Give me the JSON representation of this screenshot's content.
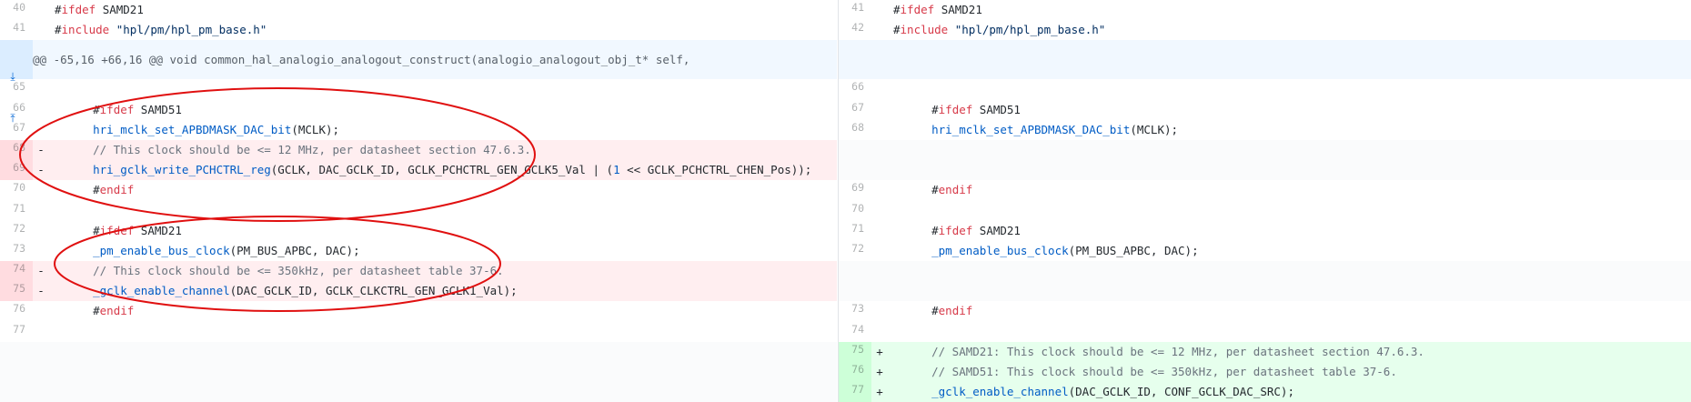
{
  "hunk_header": "@@ -65,16 +66,16 @@ void common_hal_analogio_analogout_construct(analogio_analogout_obj_t* self,",
  "expand_icons": [
    "expand-down-icon",
    "expand-up-icon"
  ],
  "left": {
    "ctx": [
      {
        "num": "40",
        "pre": "#",
        "kw": "ifdef",
        "post": " SAMD21"
      },
      {
        "num": "41",
        "pre": "#",
        "kw": "include",
        "str": " \"hpl/pm/hpl_pm_base.h\""
      }
    ],
    "r65": {
      "num": "65"
    },
    "r66": {
      "num": "66",
      "pre": "    #",
      "kw": "ifdef",
      "post": " SAMD51"
    },
    "r67": {
      "num": "67",
      "fn": "    hri_mclk_set_APBDMASK_DAC_bit",
      "post": "(MCLK);"
    },
    "r68": {
      "num": "68",
      "sign": "-",
      "cm": "    // This clock should be <= 12 MHz, per datasheet section 47.6.3."
    },
    "r69": {
      "num": "69",
      "sign": "-",
      "fn": "    hri_gclk_write_PCHCTRL_reg",
      "post": "(GCLK, DAC_GCLK_ID, GCLK_PCHCTRL_GEN_GCLK5_Val | (",
      "lit": "1",
      "post2": " << GCLK_PCHCTRL_CHEN_Pos));"
    },
    "r70": {
      "num": "70",
      "pre": "    #",
      "kw": "endif"
    },
    "r71": {
      "num": "71"
    },
    "r72": {
      "num": "72",
      "pre": "    #",
      "kw": "ifdef",
      "post": " SAMD21"
    },
    "r73": {
      "num": "73",
      "fn": "    _pm_enable_bus_clock",
      "post": "(PM_BUS_APBC, DAC);"
    },
    "r74": {
      "num": "74",
      "sign": "-",
      "cm": "    // This clock should be <= 350kHz, per datasheet table 37-6."
    },
    "r75": {
      "num": "75",
      "sign": "-",
      "fn": "    _gclk_enable_channel",
      "post": "(DAC_GCLK_ID, GCLK_CLKCTRL_GEN_GCLK1_Val);"
    },
    "r76": {
      "num": "76",
      "pre": "    #",
      "kw": "endif"
    },
    "r77": {
      "num": "77"
    }
  },
  "right": {
    "ctx": [
      {
        "num": "41",
        "pre": "#",
        "kw": "ifdef",
        "post": " SAMD21"
      },
      {
        "num": "42",
        "pre": "#",
        "kw": "include",
        "str": " \"hpl/pm/hpl_pm_base.h\""
      }
    ],
    "r66": {
      "num": "66"
    },
    "r67": {
      "num": "67",
      "pre": "    #",
      "kw": "ifdef",
      "post": " SAMD51"
    },
    "r68": {
      "num": "68",
      "fn": "    hri_mclk_set_APBDMASK_DAC_bit",
      "post": "(MCLK);"
    },
    "r69": {
      "num": "69",
      "pre": "    #",
      "kw": "endif"
    },
    "r70": {
      "num": "70"
    },
    "r71": {
      "num": "71",
      "pre": "    #",
      "kw": "ifdef",
      "post": " SAMD21"
    },
    "r72": {
      "num": "72",
      "fn": "    _pm_enable_bus_clock",
      "post": "(PM_BUS_APBC, DAC);"
    },
    "r73": {
      "num": "73",
      "pre": "    #",
      "kw": "endif"
    },
    "r74": {
      "num": "74"
    },
    "r75": {
      "num": "75",
      "sign": "+",
      "cm": "    // SAMD21: This clock should be <= 12 MHz, per datasheet section 47.6.3."
    },
    "r76": {
      "num": "76",
      "sign": "+",
      "cm": "    // SAMD51: This clock should be <= 350kHz, per datasheet table 37-6."
    },
    "r77": {
      "num": "77",
      "sign": "+",
      "fn": "    _gclk_enable_channel",
      "post": "(DAC_GCLK_ID, CONF_GCLK_DAC_SRC);"
    }
  },
  "colors": {
    "deletion_bg": "#ffeef0",
    "addition_bg": "#e6ffed",
    "hunk_bg": "#f1f8ff",
    "annotation": "#e01010"
  }
}
